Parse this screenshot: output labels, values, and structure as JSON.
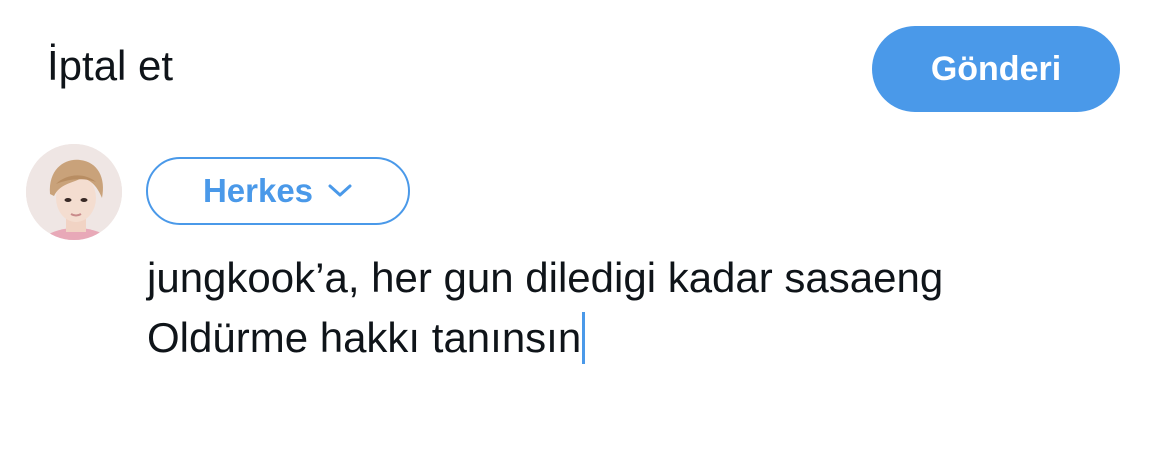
{
  "header": {
    "cancel_label": "İptal et",
    "post_label": "Gönderi"
  },
  "audience": {
    "label": "Herkes",
    "icon": "chevron-down-icon"
  },
  "compose": {
    "lines": [
      "jungkook’a, her gun diledigi kadar sasaeng",
      "Oldürme hakkı tanınsın"
    ]
  },
  "colors": {
    "accent": "#4a99e9",
    "text": "#0f1419",
    "background": "#ffffff"
  }
}
